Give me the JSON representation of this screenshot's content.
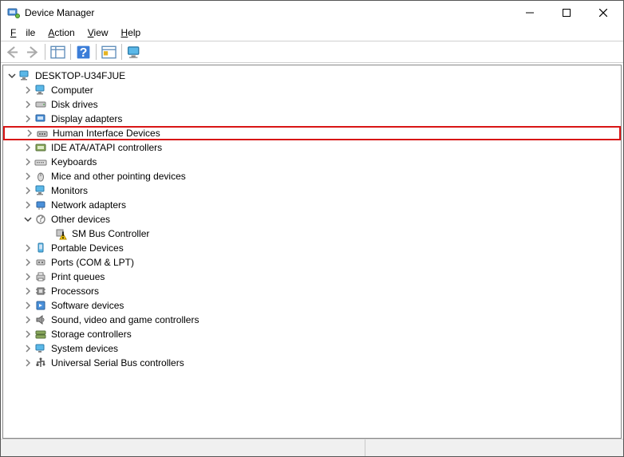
{
  "window": {
    "title": "Device Manager"
  },
  "menu": {
    "file": "File",
    "action": "Action",
    "view": "View",
    "help": "Help"
  },
  "tree": {
    "root": "DESKTOP-U34FJUE",
    "items": [
      {
        "label": "Computer",
        "icon": "monitor"
      },
      {
        "label": "Disk drives",
        "icon": "disk"
      },
      {
        "label": "Display adapters",
        "icon": "display"
      },
      {
        "label": "Human Interface Devices",
        "icon": "hid",
        "highlight": true
      },
      {
        "label": "IDE ATA/ATAPI controllers",
        "icon": "ide"
      },
      {
        "label": "Keyboards",
        "icon": "keyboard"
      },
      {
        "label": "Mice and other pointing devices",
        "icon": "mouse"
      },
      {
        "label": "Monitors",
        "icon": "monitor"
      },
      {
        "label": "Network adapters",
        "icon": "network"
      },
      {
        "label": "Other devices",
        "icon": "other",
        "expanded": true,
        "children": [
          {
            "label": "SM Bus Controller",
            "icon": "warning"
          }
        ]
      },
      {
        "label": "Portable Devices",
        "icon": "portable"
      },
      {
        "label": "Ports (COM & LPT)",
        "icon": "port"
      },
      {
        "label": "Print queues",
        "icon": "printer"
      },
      {
        "label": "Processors",
        "icon": "cpu"
      },
      {
        "label": "Software devices",
        "icon": "software"
      },
      {
        "label": "Sound, video and game controllers",
        "icon": "sound"
      },
      {
        "label": "Storage controllers",
        "icon": "storage"
      },
      {
        "label": "System devices",
        "icon": "system"
      },
      {
        "label": "Universal Serial Bus controllers",
        "icon": "usb"
      }
    ]
  }
}
